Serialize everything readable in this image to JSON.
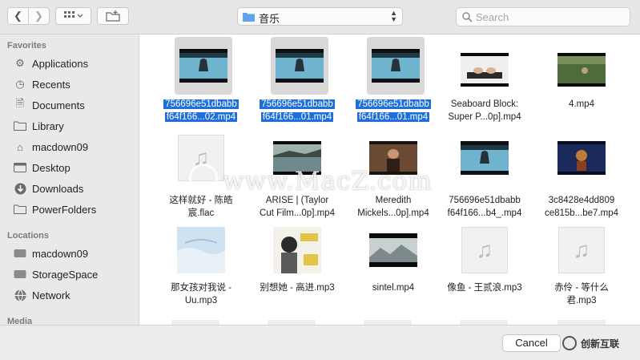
{
  "toolbar": {
    "path_label": "音乐",
    "search_placeholder": "Search"
  },
  "sidebar": {
    "sections": [
      {
        "title": "Favorites",
        "items": [
          "Applications",
          "Recents",
          "Documents",
          "Library",
          "macdown09",
          "Desktop",
          "Downloads",
          "PowerFolders"
        ]
      },
      {
        "title": "Locations",
        "items": [
          "macdown09",
          "StorageSpace",
          "Network"
        ]
      },
      {
        "title": "Media",
        "items": []
      }
    ]
  },
  "files": [
    {
      "line1": "756696e51dbabb",
      "line2": "f64f166...02.mp4",
      "kind": "bell-video",
      "selected": true
    },
    {
      "line1": "756696e51dbabb",
      "line2": "f64f166...01.mp4",
      "kind": "bell-video",
      "selected": true
    },
    {
      "line1": "756696e51dbabb",
      "line2": "f64f166...01.mp4",
      "kind": "bell-video",
      "selected": true
    },
    {
      "line1": "Seaboard Block:",
      "line2": "Super P...0p].mp4",
      "kind": "piano-video",
      "selected": false
    },
    {
      "line1": "4.mp4",
      "line2": "",
      "kind": "field-video",
      "selected": false
    },
    {
      "line1": "这样就好 - 陈皓",
      "line2": "宸.flac",
      "kind": "audio",
      "selected": false
    },
    {
      "line1": "ARISE | (Taylor",
      "line2": "Cut Film...0p].mp4",
      "kind": "lake-video",
      "selected": false
    },
    {
      "line1": "Meredith",
      "line2": "Mickels...0p].mp4",
      "kind": "dance-video",
      "selected": false
    },
    {
      "line1": "756696e51dbabb",
      "line2": "f64f166...b4_.mp4",
      "kind": "bell-video",
      "selected": false
    },
    {
      "line1": "3c8428e4dd809",
      "line2": "ce815b...be7.mp4",
      "kind": "stage-video",
      "selected": false
    },
    {
      "line1": "那女孩对我说 -",
      "line2": "Uu.mp3",
      "kind": "album-sky",
      "selected": false
    },
    {
      "line1": "别想她 - 高进.mp3",
      "line2": "",
      "kind": "album-singer",
      "selected": false
    },
    {
      "line1": "sintel.mp4",
      "line2": "",
      "kind": "sintel-video",
      "selected": false
    },
    {
      "line1": "像鱼 - 王贰浪.mp3",
      "line2": "",
      "kind": "audio",
      "selected": false
    },
    {
      "line1": "赤伶 - 等什么",
      "line2": "君.mp3",
      "kind": "audio",
      "selected": false
    }
  ],
  "footer": {
    "cancel_label": "Cancel",
    "brand_label": "创新互联"
  },
  "watermark": "www.MacZ.com",
  "colors": {
    "selection": "#1e6fd9",
    "folder": "#5ba4f0"
  }
}
